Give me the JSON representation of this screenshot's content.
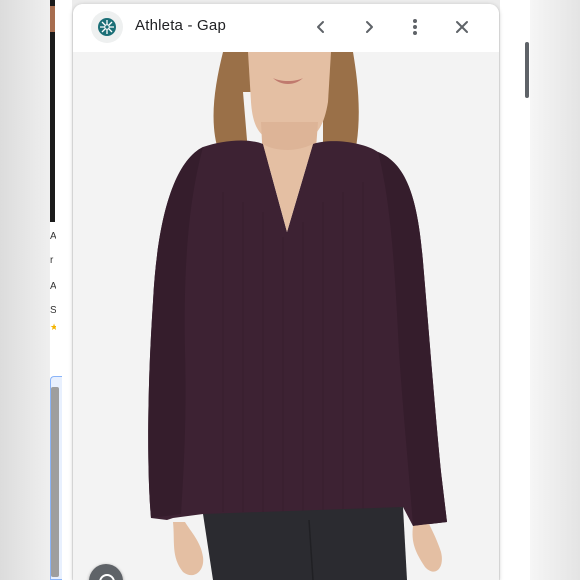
{
  "preview": {
    "site_title": "Athleta - Gap",
    "favicon": "athleta-logo-icon",
    "buttons": {
      "back": "chevron-left-icon",
      "forward": "chevron-right-icon",
      "more": "more-vert-icon",
      "close": "close-icon"
    },
    "image": {
      "alt": "Athleta - Gap",
      "product_color": "#3d2233",
      "lens_icon": "lens-icon"
    }
  },
  "colors": {
    "topbar_bg": "#ffffff",
    "title_text": "#202124",
    "icon_gray": "#5f6368",
    "accent_blue": "#8ab4f8"
  }
}
